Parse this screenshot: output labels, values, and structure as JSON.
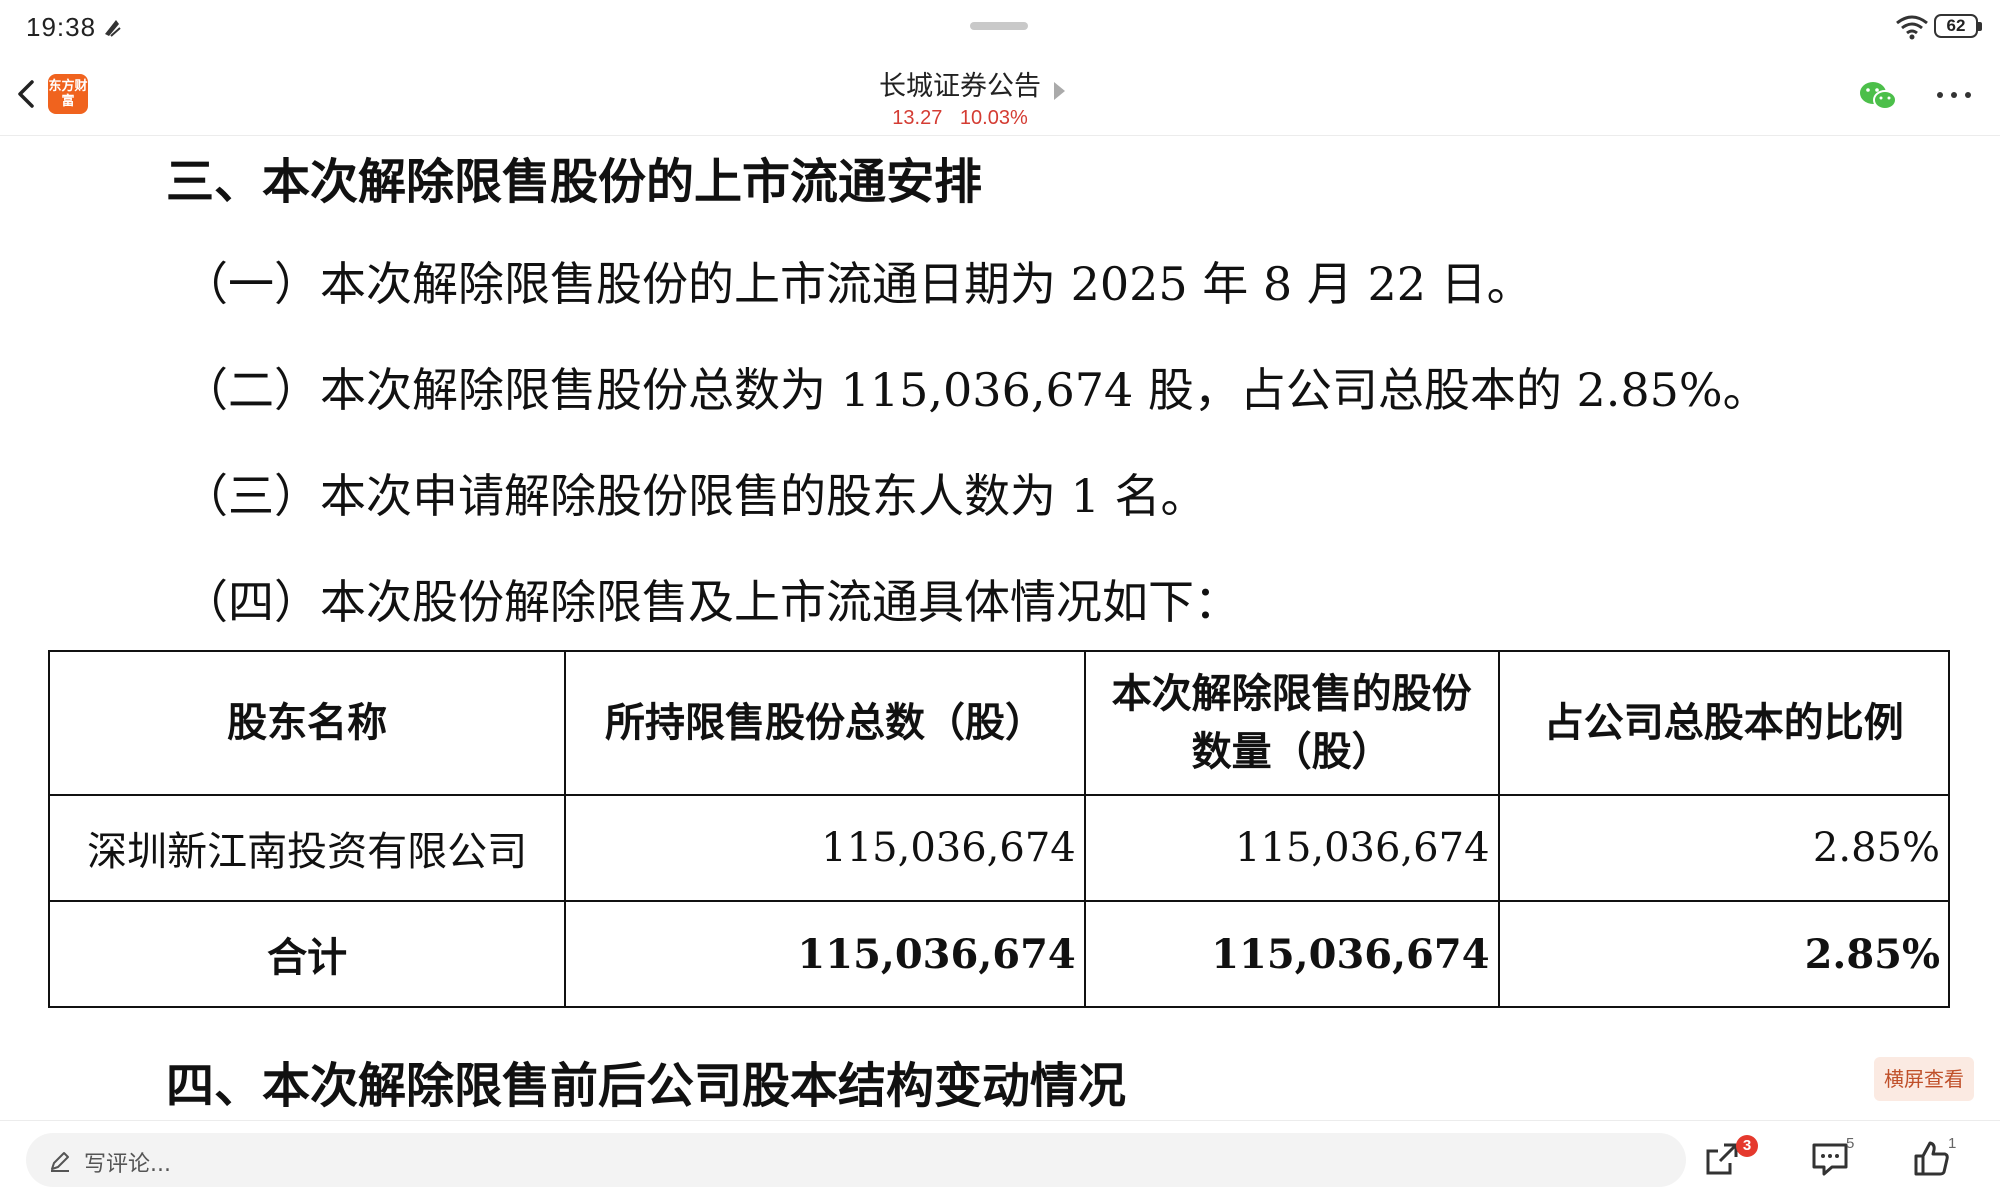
{
  "status_bar": {
    "time": "19:38",
    "battery": "62"
  },
  "header": {
    "title": "长城证券公告",
    "price": "13.27",
    "change": "10.03%",
    "logo_text": "东方财富"
  },
  "document": {
    "section3_heading": "三、本次解除限售股份的上市流通安排",
    "paragraphs": [
      "（一）本次解除限售股份的上市流通日期为 2025 年 8 月 22 日。",
      "（二）本次解除限售股份总数为 115,036,674 股，占公司总股本的 2.85%。",
      "（三）本次申请解除股份限售的股东人数为 1 名。",
      "（四）本次股份解除限售及上市流通具体情况如下："
    ],
    "table": {
      "headers": [
        "股东名称",
        "所持限售股份总数（股）",
        "本次解除限售的股份数量（股）",
        "占公司总股本的比例"
      ],
      "rows": [
        [
          "深圳新江南投资有限公司",
          "115,036,674",
          "115,036,674",
          "2.85%"
        ]
      ],
      "total": [
        "合计",
        "115,036,674",
        "115,036,674",
        "2.85%"
      ]
    },
    "section4_heading": "四、本次解除限售前后公司股本结构变动情况"
  },
  "landscape_button": "横屏查看",
  "bottom_bar": {
    "comment_placeholder": "写评论...",
    "share_badge": "3",
    "comment_count": "5",
    "like_count": "1"
  },
  "colors": {
    "accent": "#d43c33",
    "logo": "#f0631e",
    "badge": "#e5392d"
  }
}
